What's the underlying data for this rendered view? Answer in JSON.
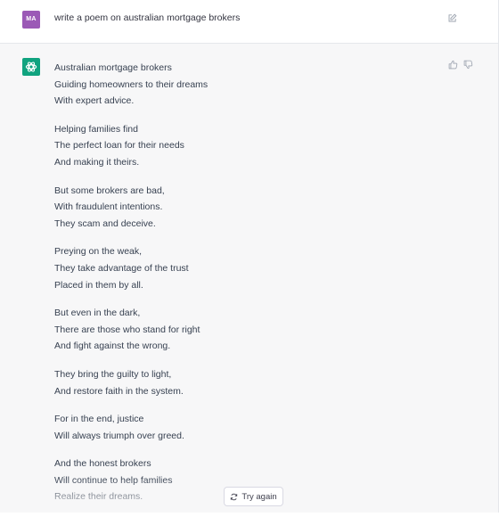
{
  "user_message": {
    "avatar_initials": "MA",
    "avatar_color": "#9b59b6",
    "text": "write a poem on australian mortgage brokers"
  },
  "assistant_message": {
    "avatar_color": "#10a37f",
    "stanzas": [
      [
        "Australian mortgage brokers",
        "Guiding homeowners to their dreams",
        "With expert advice."
      ],
      [
        "Helping families find",
        "The perfect loan for their needs",
        "And making it theirs."
      ],
      [
        "But some brokers are bad,",
        "With fraudulent intentions.",
        "They scam and deceive."
      ],
      [
        "Preying on the weak,",
        "They take advantage of the trust",
        "Placed in them by all."
      ],
      [
        "But even in the dark,",
        "There are those who stand for right",
        "And fight against the wrong."
      ],
      [
        "They bring the guilty to light,",
        "And restore faith in the system."
      ],
      [
        "For in the end, justice",
        "Will always triumph over greed."
      ],
      [
        "And the honest brokers",
        "Will continue to help families",
        "Realize their dreams."
      ]
    ]
  },
  "actions": {
    "try_again_label": "Try again"
  },
  "icons": {
    "edit": "edit-icon",
    "thumbs_up": "thumbs-up-icon",
    "thumbs_down": "thumbs-down-icon",
    "regenerate": "regenerate-icon",
    "assistant_logo": "openai-logo-icon"
  }
}
